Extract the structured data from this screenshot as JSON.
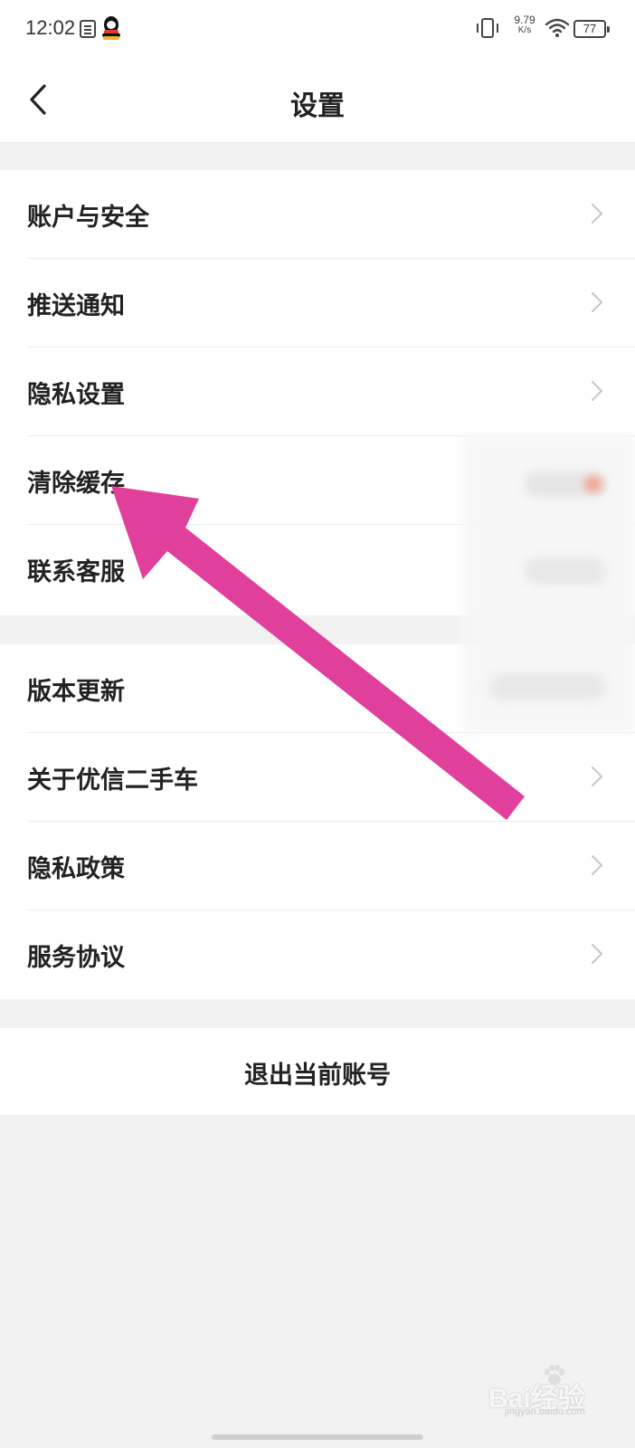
{
  "status_bar": {
    "time": "12:02",
    "net_speed_value": "9.79",
    "net_speed_unit": "K/s",
    "battery": "77"
  },
  "header": {
    "title": "设置"
  },
  "section1": {
    "items": [
      {
        "label": "账户与安全"
      },
      {
        "label": "推送通知"
      },
      {
        "label": "隐私设置"
      },
      {
        "label": "清除缓存"
      },
      {
        "label": "联系客服"
      }
    ]
  },
  "section2": {
    "items": [
      {
        "label": "版本更新"
      },
      {
        "label": "关于优信二手车"
      },
      {
        "label": "隐私政策"
      },
      {
        "label": "服务协议"
      }
    ]
  },
  "logout": {
    "label": "退出当前账号"
  },
  "watermark": {
    "brand": "Bai经验",
    "url": "jingyan.baidu.com"
  },
  "colors": {
    "arrow": "#e0409b",
    "background": "#f2f2f2",
    "text": "#222222"
  }
}
